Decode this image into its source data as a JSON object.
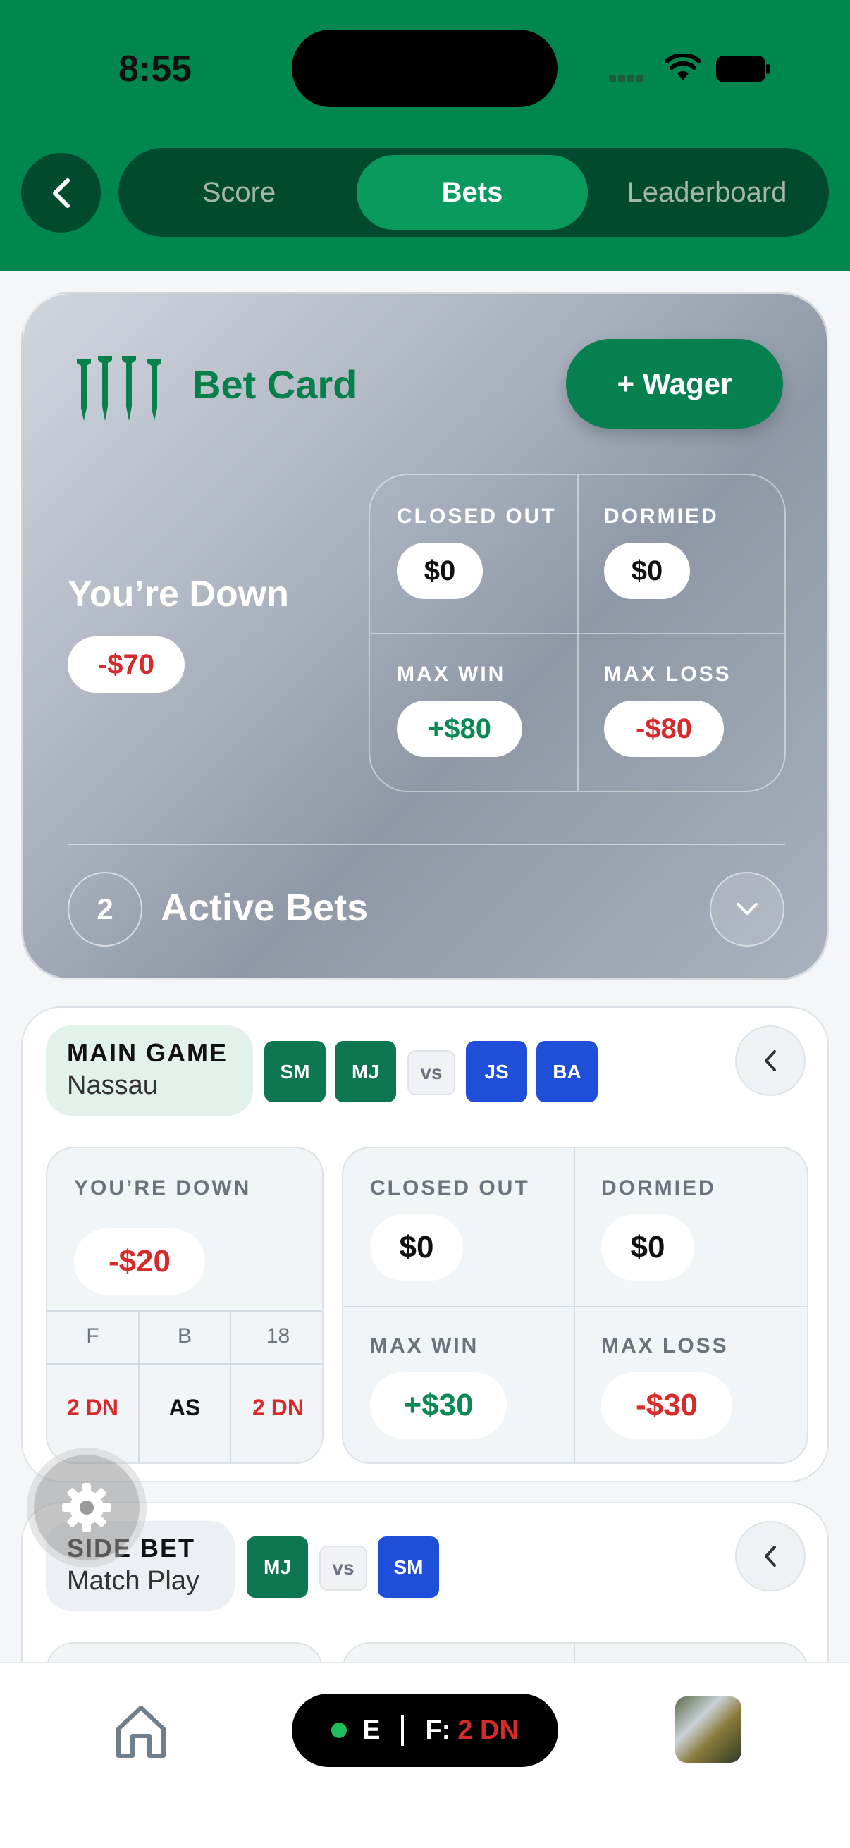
{
  "status_bar": {
    "time": "8:55"
  },
  "header": {
    "tabs": [
      {
        "label": "Score",
        "active": false
      },
      {
        "label": "Bets",
        "active": true
      },
      {
        "label": "Leaderboard",
        "active": false
      }
    ]
  },
  "bet_card": {
    "title": "Bet Card",
    "wager_button": "+ Wager",
    "status_label": "You’re Down",
    "status_amount": "-$70",
    "stats": {
      "closed_out": {
        "label": "CLOSED OUT",
        "value": "$0"
      },
      "dormied": {
        "label": "DORMIED",
        "value": "$0"
      },
      "max_win": {
        "label": "MAX WIN",
        "value": "+$80"
      },
      "max_loss": {
        "label": "MAX LOSS",
        "value": "-$80"
      }
    },
    "active_count": "2",
    "active_label": "Active Bets"
  },
  "main_game": {
    "tag_title": "MAIN GAME",
    "tag_sub": "Nassau",
    "team_a": [
      "SM",
      "MJ"
    ],
    "vs": "vs",
    "team_b": [
      "JS",
      "BA"
    ],
    "status_label": "YOU’RE DOWN",
    "status_amount": "-$20",
    "segments": [
      {
        "head": "F",
        "value": "2 DN",
        "color": "red"
      },
      {
        "head": "B",
        "value": "AS",
        "color": "dark"
      },
      {
        "head": "18",
        "value": "2 DN",
        "color": "red"
      }
    ],
    "stats": {
      "closed_out": {
        "label": "CLOSED OUT",
        "value": "$0"
      },
      "dormied": {
        "label": "DORMIED",
        "value": "$0"
      },
      "max_win": {
        "label": "MAX WIN",
        "value": "+$30"
      },
      "max_loss": {
        "label": "MAX LOSS",
        "value": "-$30"
      }
    }
  },
  "side_bet": {
    "tag_title": "SIDE BET",
    "tag_sub": "Match Play",
    "team_a": [
      "MJ"
    ],
    "vs": "vs",
    "team_b": [
      "SM"
    ]
  },
  "bottom_bar": {
    "hole": "E",
    "front_label": "F:",
    "front_value": "2 DN"
  },
  "colors": {
    "brand_green": "#00874f",
    "loss_red": "#d72a2a",
    "win_green": "#0a8a52",
    "team_blue": "#1f4fd8"
  }
}
